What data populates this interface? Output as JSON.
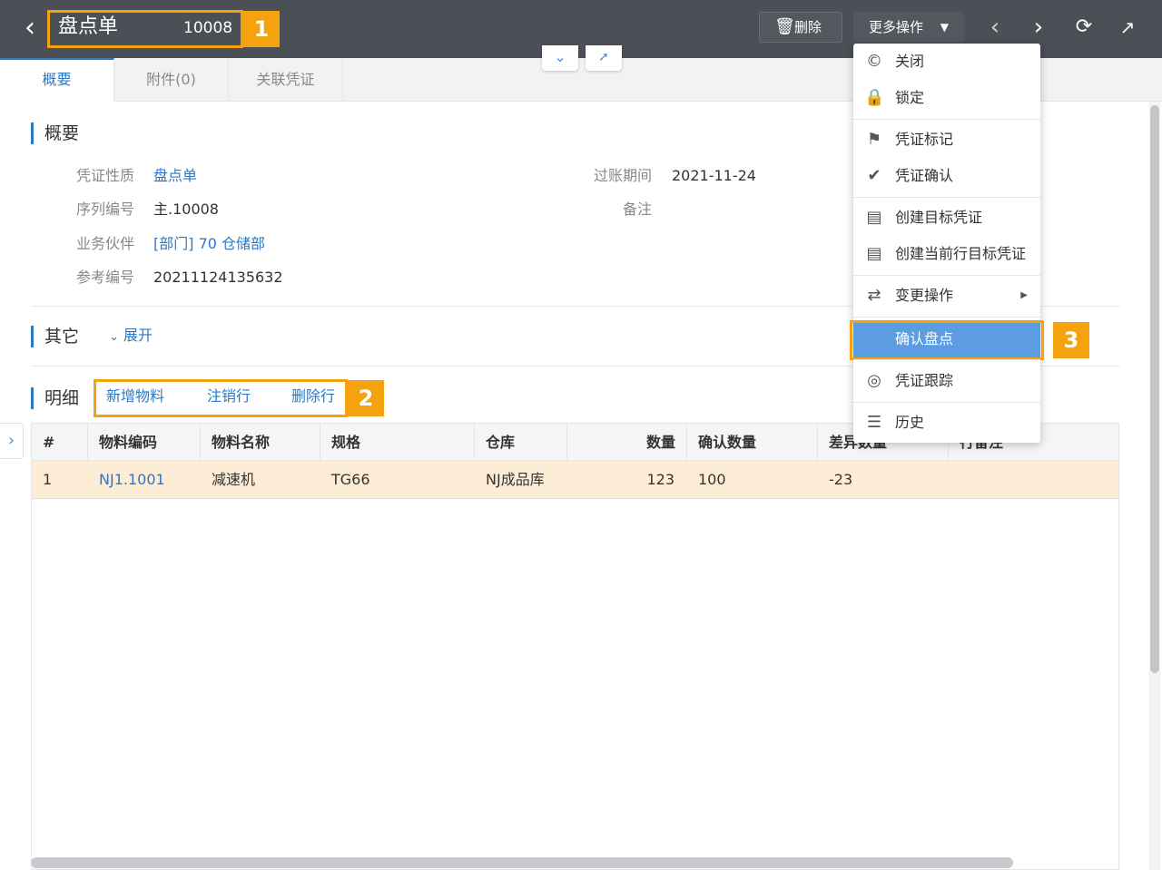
{
  "header": {
    "back_icon": "chevron-left-icon",
    "title": "盘点单",
    "doc_no": "10008",
    "delete_label": "删除",
    "more_label": "更多操作"
  },
  "callouts": [
    "1",
    "2",
    "3"
  ],
  "tabs": [
    {
      "label": "概要",
      "active": true
    },
    {
      "label": "附件(0)",
      "active": false
    },
    {
      "label": "关联凭证",
      "active": false
    }
  ],
  "summary": {
    "section_title": "概要",
    "fields": [
      {
        "label": "凭证性质",
        "value": "盘点单"
      },
      {
        "label": "序列编号",
        "value": "主.10008"
      },
      {
        "label": "业务伙伴",
        "value": "[部门] 70 仓储部"
      },
      {
        "label": "参考编号",
        "value": "20211124135632"
      }
    ],
    "right_fields": [
      {
        "label": "过账期间",
        "value": "2021-11-24"
      },
      {
        "label": "备注",
        "value": ""
      }
    ]
  },
  "other": {
    "section_title": "其它",
    "expand_label": "展开"
  },
  "detail": {
    "section_title": "明细",
    "actions": [
      "新增物料",
      "注销行",
      "删除行"
    ],
    "columns": [
      "#",
      "物料编码",
      "物料名称",
      "规格",
      "仓库",
      "数量",
      "确认数量",
      "差异数量",
      "行备注"
    ],
    "rows": [
      {
        "no": "1",
        "code": "NJ1.1001",
        "name": "减速机",
        "spec": "TG66",
        "warehouse": "NJ成品库",
        "qty": "123",
        "confirm_qty": "100",
        "diff": "-23"
      }
    ]
  },
  "menu": {
    "items": [
      {
        "label": "关闭",
        "icon": "copyright-circle-icon"
      },
      {
        "label": "锁定",
        "icon": "lock-icon"
      },
      {
        "label": "凭证标记",
        "icon": "flag-icon"
      },
      {
        "label": "凭证确认",
        "icon": "check-circle-icon"
      },
      {
        "label": "创建目标凭证",
        "icon": "document-icon"
      },
      {
        "label": "创建当前行目标凭证",
        "icon": "document-icon"
      },
      {
        "label": "变更操作",
        "icon": "switch-icon"
      },
      {
        "label": "确认盘点",
        "icon": ""
      },
      {
        "label": "凭证跟踪",
        "icon": "target-icon"
      },
      {
        "label": "历史",
        "icon": "layers-icon"
      }
    ]
  },
  "colors": {
    "accent": "#2a78c6",
    "callout": "#f4a20d",
    "topbar": "#4b4f56",
    "highlight_row": "#fdecd6",
    "menu_highlight": "#5b9de0"
  }
}
